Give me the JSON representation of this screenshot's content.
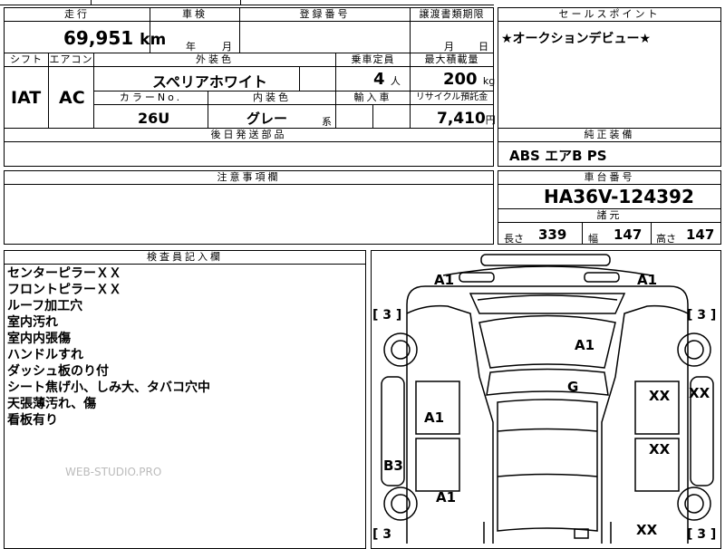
{
  "top_fragment": "",
  "mileage": {
    "label": "走行",
    "value": "69,951",
    "unit": "km"
  },
  "shaken": {
    "label": "車検",
    "year_suffix": "年",
    "month_suffix": "月"
  },
  "registration": {
    "label": "登録番号",
    "value": ""
  },
  "transfer_deadline": {
    "label": "譲渡書類期限",
    "month_suffix": "月",
    "day_suffix": "日"
  },
  "sales_point": {
    "label": "セールスポイント",
    "text": "★オークションデビュー★"
  },
  "shift": {
    "label": "シフト",
    "value": "IAT"
  },
  "aircon": {
    "label": "エアコン",
    "value": "AC"
  },
  "exterior_color": {
    "label": "外装色",
    "value": "スペリアホワイト"
  },
  "capacity": {
    "label": "乗車定員",
    "value": "4",
    "unit": "人"
  },
  "max_load": {
    "label": "最大積載量",
    "value": "200",
    "unit": "kg"
  },
  "color_no": {
    "label": "カラーNo.",
    "value": "26U"
  },
  "interior_color": {
    "label": "内装色",
    "value": "グレー",
    "suffix": "系"
  },
  "import": {
    "label": "輸入車",
    "value": ""
  },
  "recycle": {
    "label": "リサイクル預託金",
    "value": "7,410",
    "unit": "円"
  },
  "later_parts": {
    "label": "後日発送部品",
    "value": ""
  },
  "equipment": {
    "label": "純正装備",
    "value": "ABS エアB PS"
  },
  "caution": {
    "label": "注意事項欄",
    "value": ""
  },
  "chassis": {
    "label": "車台番号",
    "value": "HA36V-124392"
  },
  "dims": {
    "label": "諸元",
    "length_label": "長さ",
    "length": "339",
    "width_label": "幅",
    "width": "147",
    "height_label": "高さ",
    "height": "147"
  },
  "inspector": {
    "label": "検査員記入欄",
    "notes": [
      "センターピラーＸＸ",
      "フロントピラーＸＸ",
      "ルーフ加工穴",
      "室内汚れ",
      "室内内張傷",
      "ハンドルすれ",
      "ダッシュ板のり付",
      "シート焦げ小、しみ大、タバコ穴中",
      "天張薄汚れ、傷",
      "看板有り"
    ]
  },
  "watermark": "WEB-STUDIO.PRO",
  "diagram": {
    "labels": {
      "a1_top_left": "A1",
      "a1_top_right": "A1",
      "a1_roof": "A1",
      "g_center": "G",
      "a1_left_door": "A1",
      "b3_left": "B3",
      "a1_left_rear": "A1",
      "xx_right_front_door": "XX",
      "xx_right_fender": "XX",
      "xx_right_rear_door": "XX",
      "xx_right_rear": "XX"
    },
    "tires": {
      "tl": "[ 3 ]",
      "tr": "[ 3 ]",
      "bl": "[ 3",
      "br": "[ 3 ]"
    }
  }
}
